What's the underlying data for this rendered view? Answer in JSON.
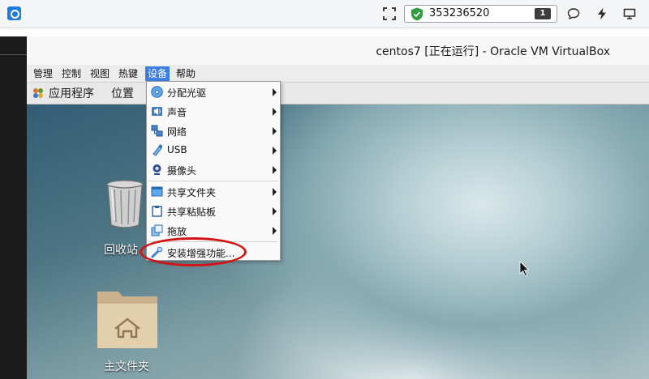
{
  "connection": {
    "id": "353236520",
    "count": "1"
  },
  "vbox": {
    "title": "centos7 [正在运行] - Oracle VM VirtualBox",
    "menus": [
      {
        "label": "管理"
      },
      {
        "label": "控制"
      },
      {
        "label": "视图"
      },
      {
        "label": "热键"
      },
      {
        "label": "设备"
      },
      {
        "label": "帮助"
      }
    ]
  },
  "guest": {
    "panel": {
      "applications": "应用程序",
      "places": "位置"
    },
    "desktop_icons": {
      "trash": "回收站",
      "home": "主文件夹"
    }
  },
  "device_menu": {
    "items": [
      {
        "label": "分配光驱",
        "icon": "optical-disc-icon"
      },
      {
        "label": "声音",
        "icon": "audio-icon"
      },
      {
        "label": "网络",
        "icon": "network-icon"
      },
      {
        "label": "USB",
        "icon": "usb-icon"
      },
      {
        "label": "摄像头",
        "icon": "webcam-icon"
      },
      {
        "label": "共享文件夹",
        "icon": "shared-folder-icon"
      },
      {
        "label": "共享粘贴板",
        "icon": "clipboard-icon"
      },
      {
        "label": "拖放",
        "icon": "drag-drop-icon"
      },
      {
        "label": "安装增强功能...",
        "icon": "guest-additions-icon"
      }
    ]
  },
  "colors": {
    "accent": "#3c7ee0",
    "highlight_ring": "#d41414",
    "shield": "#2e9e3f"
  }
}
